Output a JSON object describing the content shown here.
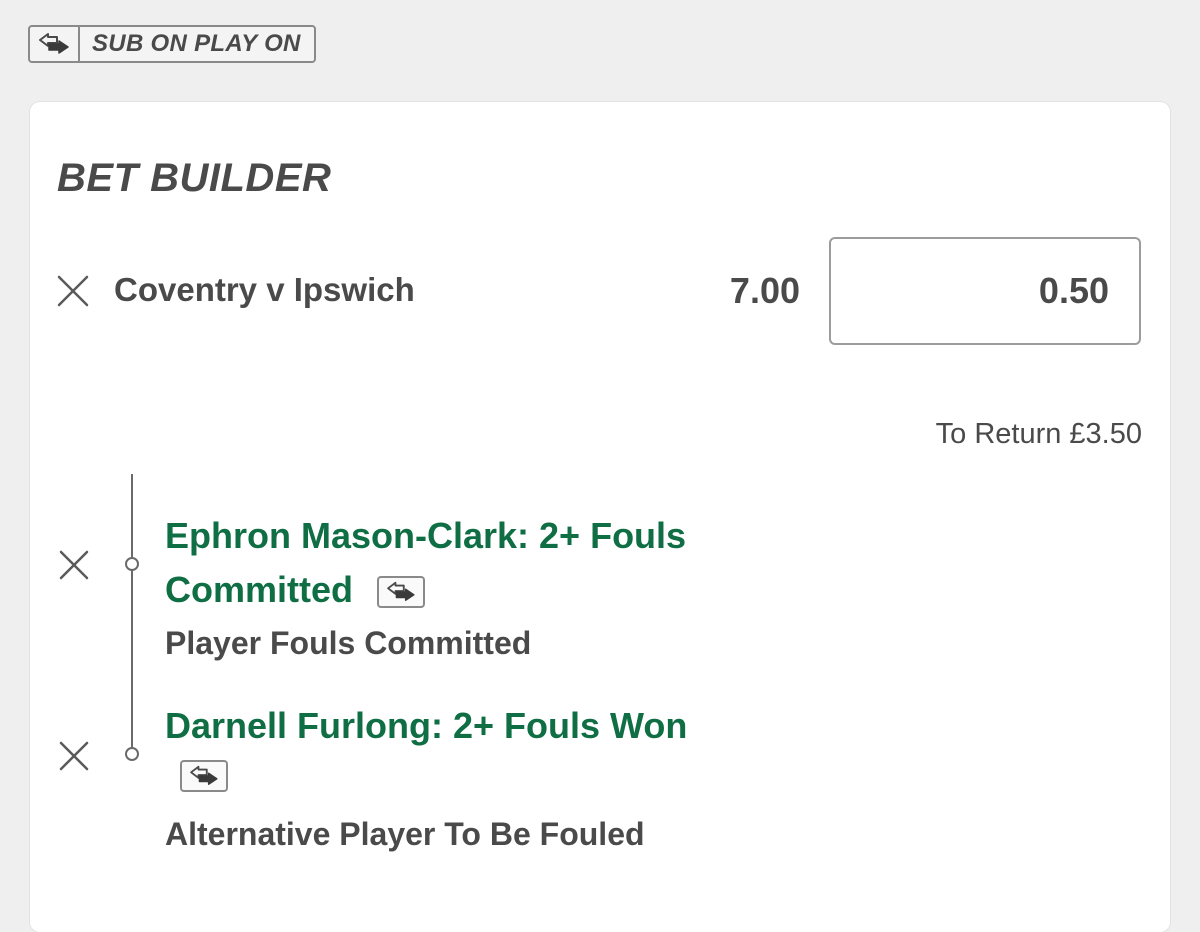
{
  "badge": {
    "icon": "sub-swap-icon",
    "label": "SUB ON PLAY ON"
  },
  "bet_builder": {
    "title": "BET BUILDER",
    "event": {
      "name": "Coventry v Ipswich",
      "odds": "7.00",
      "stake": "0.50",
      "to_return": "To Return £3.50"
    },
    "selections": [
      {
        "title_line1": "Ephron Mason-Clark: 2+ Fouls",
        "title_line2": "Committed",
        "market": "Player Fouls Committed",
        "has_sub_icon": true
      },
      {
        "title_line1": "Darnell Furlong: 2+ Fouls Won",
        "market": "Alternative Player To Be Fouled",
        "has_sub_icon": true
      }
    ]
  },
  "colors": {
    "selection_green": "#0f6e44",
    "text_grey": "#4a4a4a",
    "background": "#efefef",
    "card": "#ffffff"
  }
}
